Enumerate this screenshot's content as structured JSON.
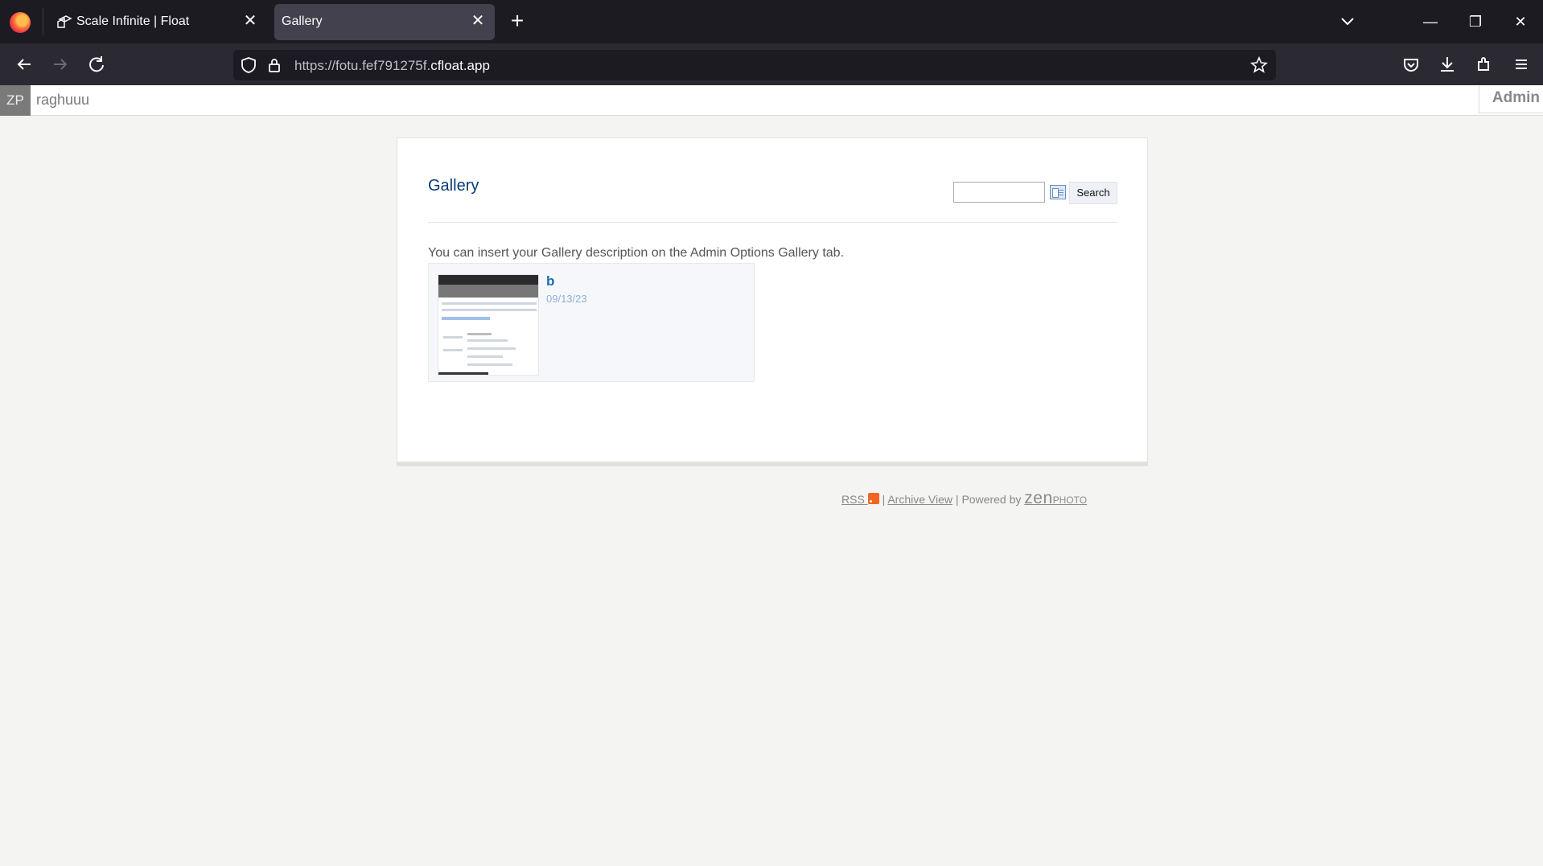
{
  "browser": {
    "tabs": [
      {
        "title": "Scale Infinite | Float",
        "active": false
      },
      {
        "title": "Gallery",
        "active": true
      }
    ],
    "url_prefix": "https://fotu.fef791275f.",
    "url_host": "cfloat.app"
  },
  "adminbar": {
    "badge": "ZP",
    "site_name": "raghuuu",
    "admin_label": "Admin"
  },
  "gallery": {
    "title": "Gallery",
    "search_button": "Search",
    "description": "You can insert your Gallery description on the Admin Options Gallery tab.",
    "albums": [
      {
        "title": "b",
        "date": "09/13/23"
      }
    ]
  },
  "footer": {
    "rss": "RSS",
    "sep1": "|",
    "archive": "Archive View",
    "sep2": "|",
    "powered_by": "Powered by",
    "zen": "zen",
    "photo": "PHOTO"
  },
  "colors": {
    "title_blue": "#0a3a7a",
    "album_blue": "#1a6ab8",
    "rss_orange": "#f26522"
  }
}
